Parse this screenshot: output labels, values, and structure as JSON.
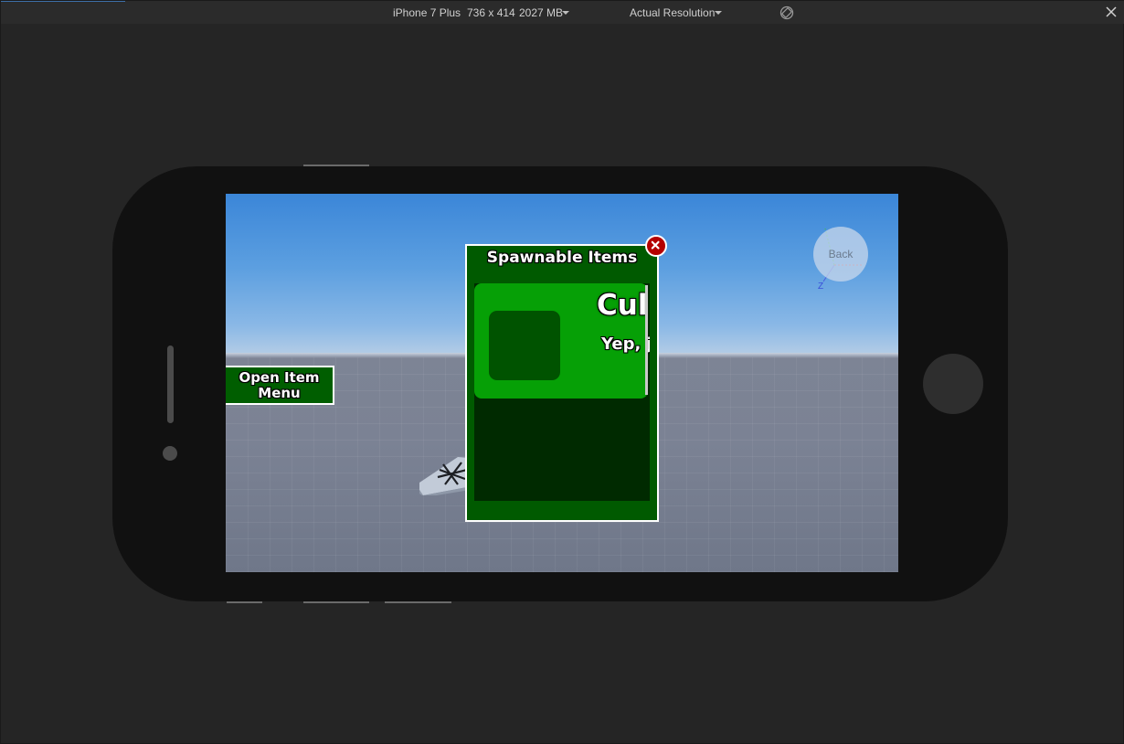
{
  "toolbar": {
    "device": "iPhone 7 Plus",
    "resolution": "736 x 414",
    "memory": "2027 MB",
    "scale": "Actual Resolution"
  },
  "game": {
    "open_menu_button": "Open Item Menu",
    "camera_widget_label": "Back",
    "axis_label": "Z"
  },
  "panel": {
    "title": "Spawnable Items",
    "items": [
      {
        "name": "Cul",
        "description": "Yep, ju normal"
      }
    ]
  },
  "colors": {
    "panel_green": "#005a00",
    "card_green": "#06a006",
    "list_bg": "#002a00",
    "close_red": "#b40000"
  }
}
